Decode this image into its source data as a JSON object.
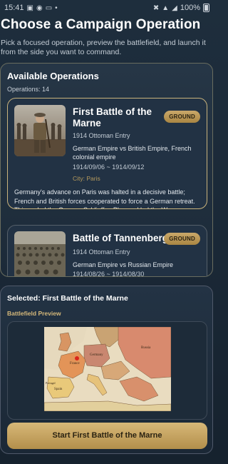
{
  "status_bar": {
    "time": "15:41",
    "left_icons": [
      "photo-icon",
      "facebook-icon",
      "cast-icon",
      "dot-icon"
    ],
    "right_icons": [
      "mute-icon",
      "wifi-icon",
      "signal-icon"
    ],
    "battery": "100%"
  },
  "header": {
    "title": "Choose a Campaign Operation",
    "subtitle": "Pick a focused operation, preview the battlefield, and launch it from the side you want to command."
  },
  "operations": {
    "title": "Available Operations",
    "count": "Operations: 14",
    "items": [
      {
        "name": "First Battle of the Marne",
        "badge": "GROUND",
        "entry": "1914 Ottoman Entry",
        "sides": "German Empire vs British Empire, French colonial empire",
        "dates": "1914/09/06 ~ 1914/09/12",
        "city": "City: Paris",
        "description": "Germany's advance on Paris was halted in a decisive battle; French and British forces cooperated to force a German retreat. This ended the German Schlieffen Plan and led the W..."
      },
      {
        "name": "Battle of Tannenberg",
        "badge": "GROUND",
        "entry": "1914 Ottoman Entry",
        "sides": "German Empire vs Russian Empire",
        "dates": "1914/08/26 ~ 1914/08/30"
      }
    ]
  },
  "selected": {
    "title": "Selected: First Battle of the Marne",
    "preview_label": "Battlefield Preview",
    "map_labels": [
      "France",
      "Spain",
      "Germany",
      "Russia",
      "Portugal"
    ],
    "start_button": "Start First Battle of the Marne"
  },
  "colors": {
    "accent_gold": "#c9a865",
    "background": "#1e2e3d"
  }
}
